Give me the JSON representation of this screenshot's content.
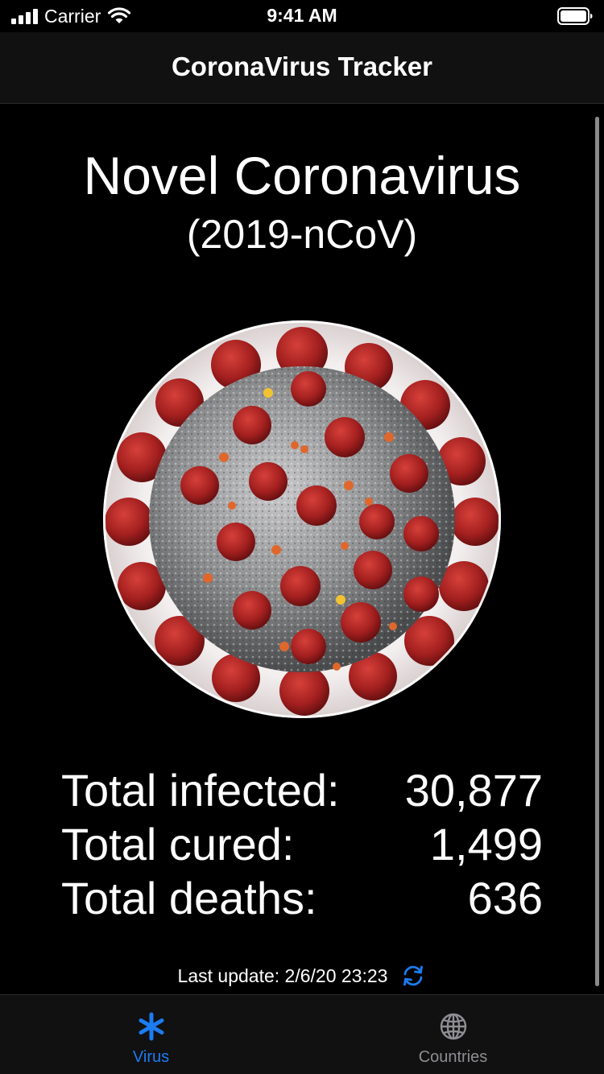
{
  "status_bar": {
    "carrier": "Carrier",
    "time": "9:41 AM",
    "icons": [
      "signal-icon",
      "wifi-icon",
      "battery-icon"
    ]
  },
  "nav": {
    "title": "CoronaVirus Tracker"
  },
  "heading": {
    "line1": "Novel Coronavirus",
    "line2": "(2019-nCoV)"
  },
  "stats": [
    {
      "label": "Total infected:",
      "value": "30,877"
    },
    {
      "label": "Total cured:",
      "value": "1,499"
    },
    {
      "label": "Total deaths:",
      "value": "636"
    }
  ],
  "footer": {
    "last_update": "Last update: 2/6/20 23:23",
    "refresh_icon": "refresh-icon"
  },
  "tabs": [
    {
      "label": "Virus",
      "icon": "asterisk-icon",
      "selected": true
    },
    {
      "label": "Countries",
      "icon": "globe-icon",
      "selected": false
    }
  ],
  "colors": {
    "background": "#000000",
    "bar_background": "#111111",
    "accent": "#1c7cf2",
    "inactive_tab": "#8e8e93",
    "virus_red": "#a3201f",
    "virus_gray": "#8f9092"
  }
}
